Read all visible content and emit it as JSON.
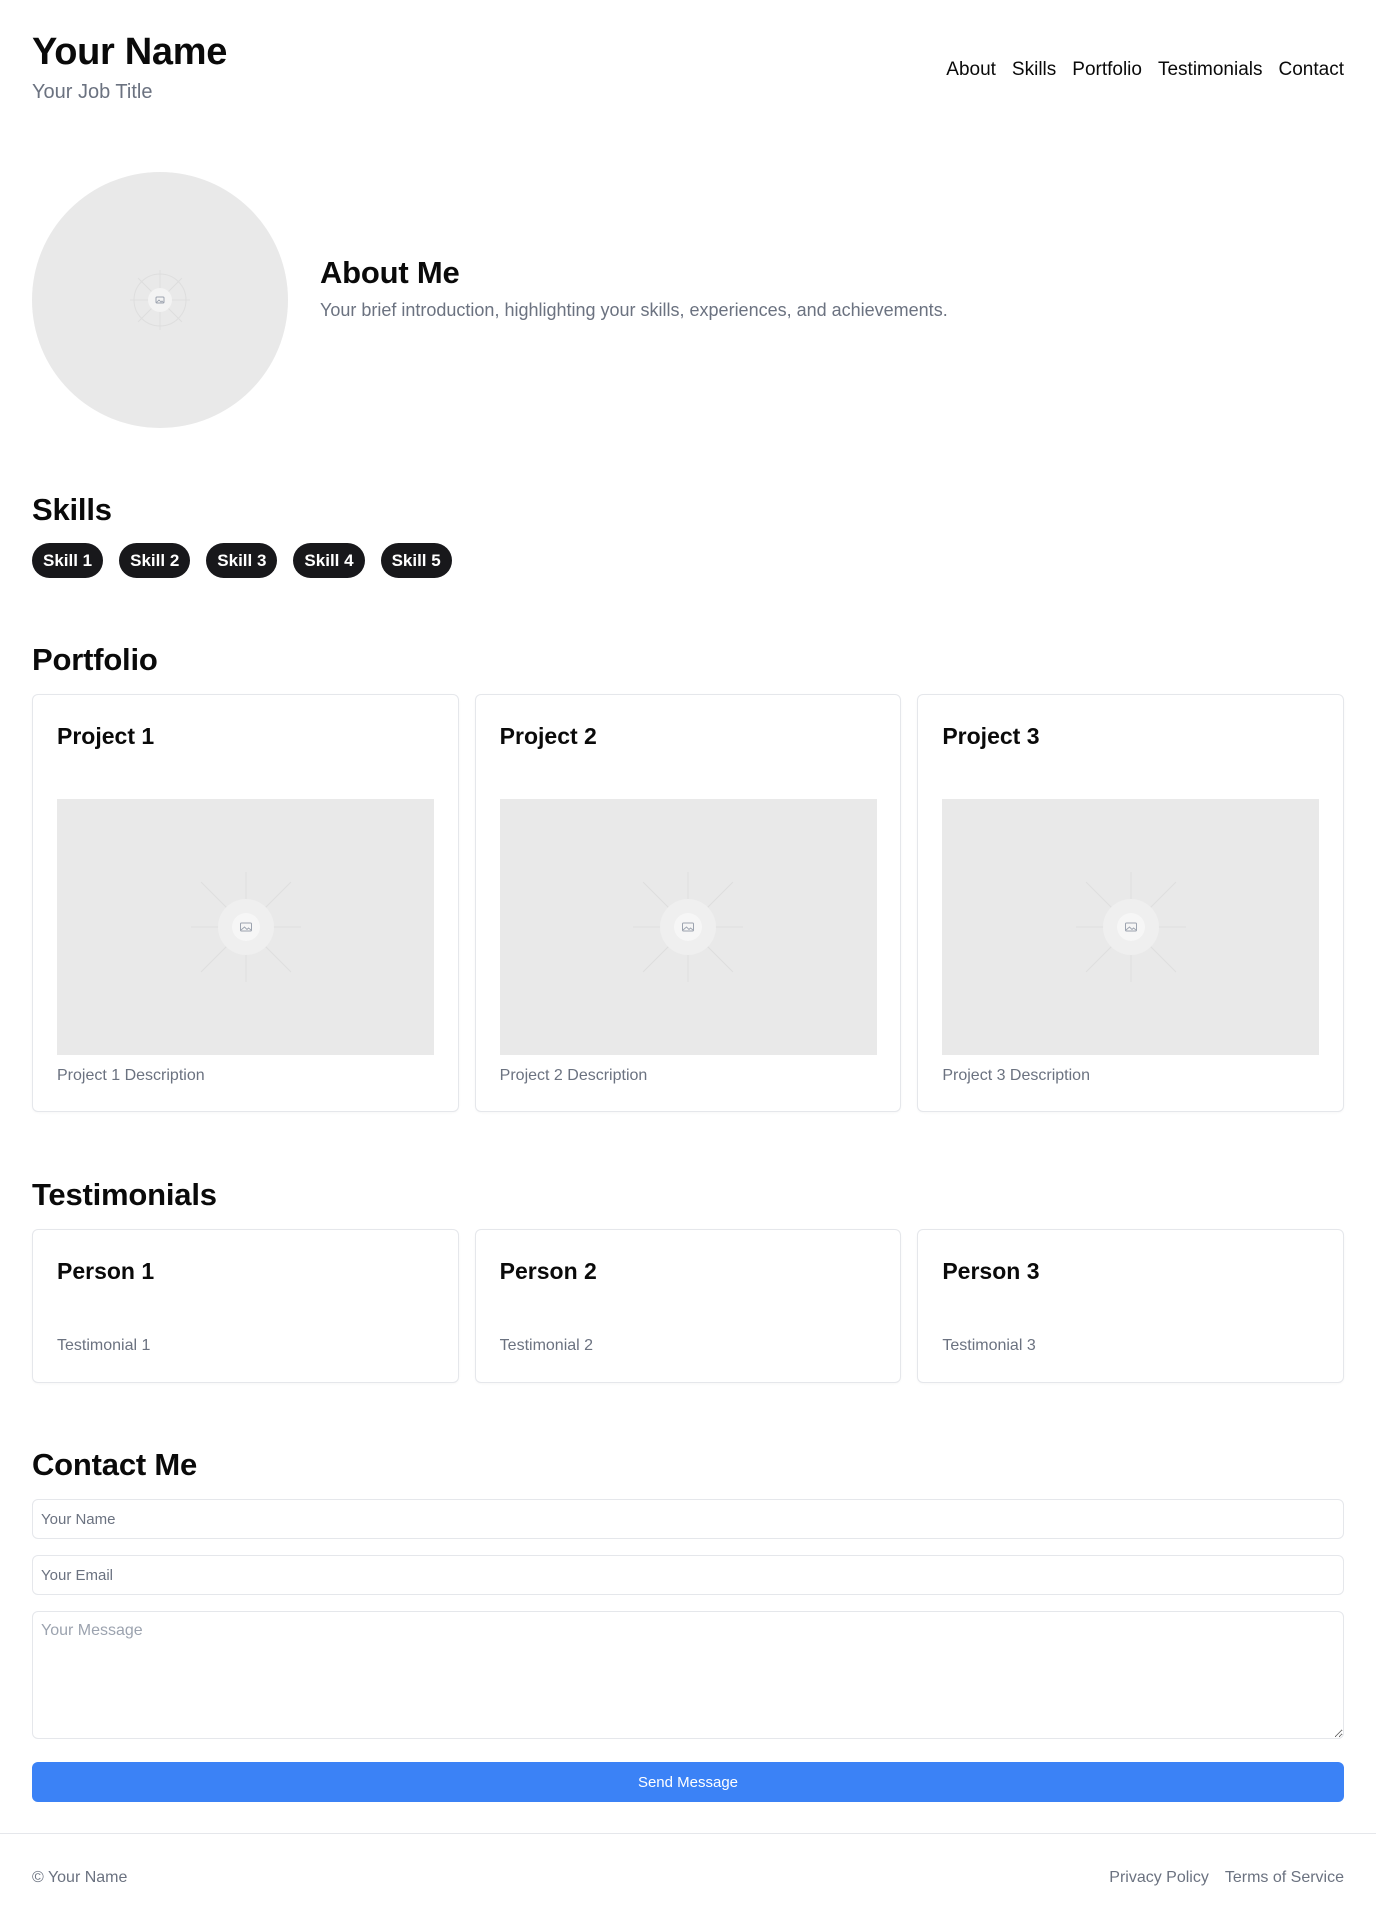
{
  "header": {
    "name": "Your Name",
    "job_title": "Your Job Title",
    "nav": [
      {
        "label": "About"
      },
      {
        "label": "Skills"
      },
      {
        "label": "Portfolio"
      },
      {
        "label": "Testimonials"
      },
      {
        "label": "Contact"
      }
    ]
  },
  "about": {
    "heading": "About Me",
    "text": "Your brief introduction, highlighting your skills, experiences, and achievements.",
    "avatar_icon": "image-placeholder-icon"
  },
  "skills": {
    "heading": "Skills",
    "items": [
      "Skill 1",
      "Skill 2",
      "Skill 3",
      "Skill 4",
      "Skill 5"
    ]
  },
  "portfolio": {
    "heading": "Portfolio",
    "projects": [
      {
        "title": "Project 1",
        "description": "Project 1 Description"
      },
      {
        "title": "Project 2",
        "description": "Project 2 Description"
      },
      {
        "title": "Project 3",
        "description": "Project 3 Description"
      }
    ]
  },
  "testimonials": {
    "heading": "Testimonials",
    "items": [
      {
        "person": "Person 1",
        "text": "Testimonial 1"
      },
      {
        "person": "Person 2",
        "text": "Testimonial 2"
      },
      {
        "person": "Person 3",
        "text": "Testimonial 3"
      }
    ]
  },
  "contact": {
    "heading": "Contact Me",
    "name_placeholder": "Your Name",
    "email_placeholder": "Your Email",
    "message_placeholder": "Your Message",
    "send_label": "Send Message"
  },
  "footer": {
    "copyright": "© Your Name",
    "privacy_label": "Privacy Policy",
    "terms_label": "Terms of Service"
  },
  "colors": {
    "accent": "#3b82f6",
    "chip_bg": "#18181b",
    "muted_text": "#6b7280",
    "placeholder_bg": "#e9e9e9"
  }
}
